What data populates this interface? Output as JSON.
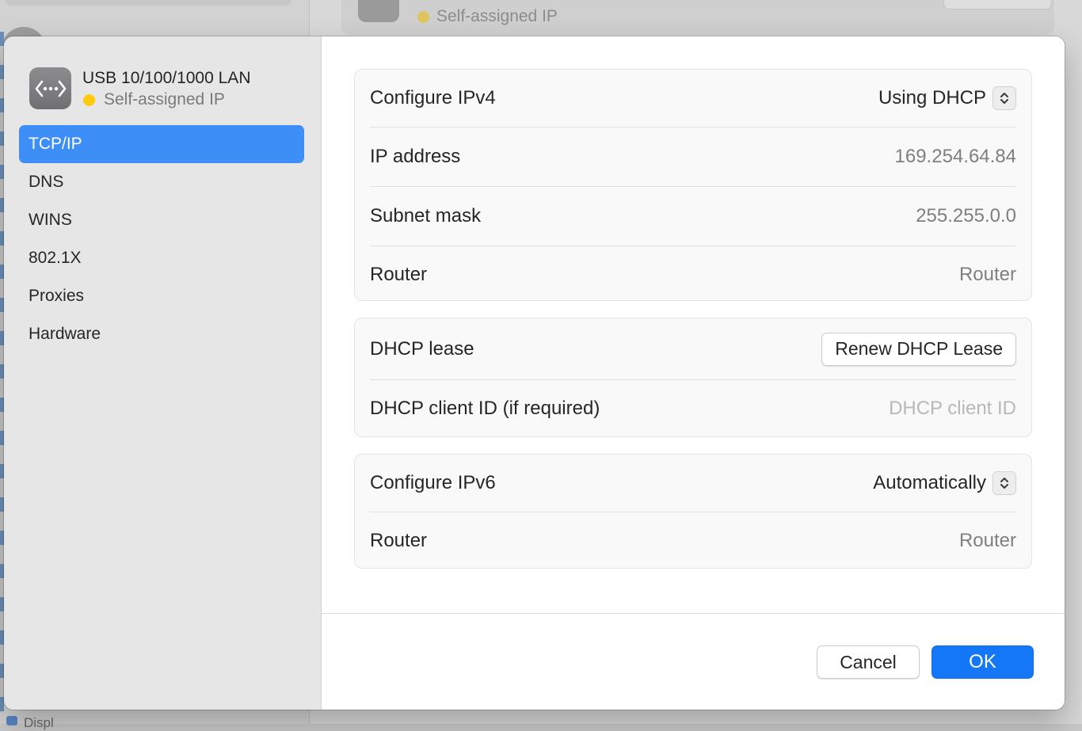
{
  "background": {
    "status": "Self-assigned IP",
    "peek_text": "Displ"
  },
  "interface": {
    "name": "USB 10/100/1000 LAN",
    "status": "Self-assigned IP",
    "status_color": "#fecb0f",
    "icon": "ethernet-arrows-icon"
  },
  "sidebar": {
    "items": [
      {
        "label": "TCP/IP",
        "selected": true
      },
      {
        "label": "DNS"
      },
      {
        "label": "WINS"
      },
      {
        "label": "802.1X"
      },
      {
        "label": "Proxies"
      },
      {
        "label": "Hardware"
      }
    ]
  },
  "ipv4": {
    "configure_label": "Configure IPv4",
    "configure_value": "Using DHCP",
    "ip_label": "IP address",
    "ip_value": "169.254.64.84",
    "subnet_label": "Subnet mask",
    "subnet_value": "255.255.0.0",
    "router_label": "Router",
    "router_value": "Router"
  },
  "dhcp": {
    "lease_label": "DHCP lease",
    "renew_button": "Renew DHCP Lease",
    "client_id_label": "DHCP client ID (if required)",
    "client_id_placeholder": "DHCP client ID"
  },
  "ipv6": {
    "configure_label": "Configure IPv6",
    "configure_value": "Automatically",
    "router_label": "Router",
    "router_value": "Router"
  },
  "footer": {
    "cancel": "Cancel",
    "ok": "OK"
  },
  "colors": {
    "accent": "#3d8ef6",
    "primary_button": "#1477f7"
  }
}
